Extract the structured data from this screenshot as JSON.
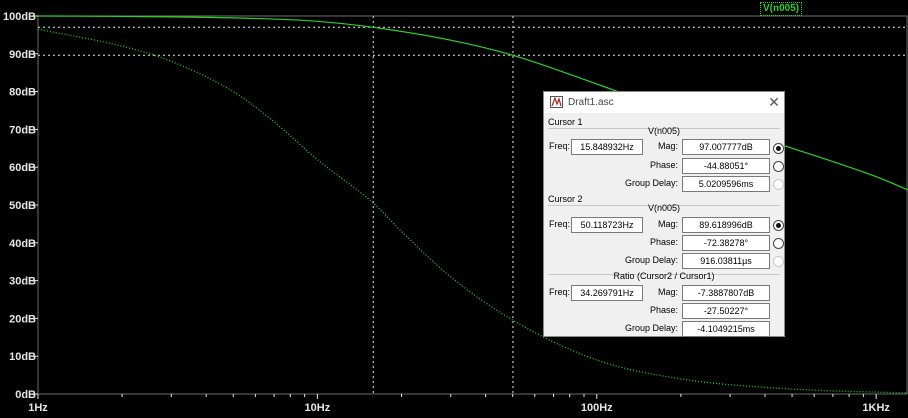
{
  "trace_label": "V(n005)",
  "colors": {
    "background": "#000000",
    "trace": "#2bd12b",
    "grid": "#6b6b6b",
    "axis_text": "#e6e6e6"
  },
  "chart_data": {
    "type": "line",
    "xscale": "log",
    "xlim": [
      1,
      1300
    ],
    "ylim": [
      0,
      100
    ],
    "x_ticks": [
      1,
      10,
      100,
      1000
    ],
    "x_tick_labels": [
      "1Hz",
      "10Hz",
      "100Hz",
      "1KHz"
    ],
    "y_ticks": [
      0,
      10,
      20,
      30,
      40,
      50,
      60,
      70,
      80,
      90,
      100
    ],
    "y_tick_labels": [
      "0dB",
      "10dB",
      "20dB",
      "30dB",
      "40dB",
      "50dB",
      "60dB",
      "70dB",
      "80dB",
      "90dB",
      "100dB"
    ],
    "grid": false,
    "series": [
      {
        "name": "V(n005)",
        "style": "solid",
        "x": [
          1,
          2,
          5,
          10,
          15.85,
          30,
          50.12,
          100,
          200,
          500,
          1000,
          1300
        ],
        "y": [
          100,
          99.9,
          99.5,
          98.6,
          97.0,
          93.6,
          89.6,
          82.0,
          74.0,
          65.0,
          57.5,
          54.0
        ]
      },
      {
        "name": "V(n005)",
        "style": "dotted",
        "x": [
          1,
          2,
          3,
          5,
          7,
          10,
          15.85,
          20,
          30,
          50.12,
          100,
          200,
          500,
          1000,
          1300
        ],
        "y": [
          96.5,
          92,
          88,
          80,
          72,
          62,
          50.5,
          43,
          31,
          19.5,
          9,
          4,
          1.3,
          0.5,
          0.3
        ]
      }
    ],
    "cursors": [
      {
        "freq": 15.848932,
        "mag_db": 97.007777
      },
      {
        "freq": 50.118723,
        "mag_db": 89.618996
      }
    ]
  },
  "dialog": {
    "title": "Draft1.asc",
    "close_icon": "close-icon",
    "cursor1": {
      "header": "Cursor 1",
      "trace": "V(n005)",
      "freq_label": "Freq:",
      "freq": "15.848932Hz",
      "mag_label": "Mag:",
      "mag": "97.007777dB",
      "phase_label": "Phase:",
      "phase": "-44.88051°",
      "gd_label": "Group Delay:",
      "gd": "5.0209596ms"
    },
    "cursor2": {
      "header": "Cursor 2",
      "trace": "V(n005)",
      "freq_label": "Freq:",
      "freq": "50.118723Hz",
      "mag_label": "Mag:",
      "mag": "89.618996dB",
      "phase_label": "Phase:",
      "phase": "-72.38278°",
      "gd_label": "Group Delay:",
      "gd": "916.03811µs"
    },
    "ratio": {
      "header": "Ratio (Cursor2 / Cursor1)",
      "freq_label": "Freq:",
      "freq": "34.269791Hz",
      "mag_label": "Mag:",
      "mag": "-7.3887807dB",
      "phase_label": "Phase:",
      "phase": "-27.50227°",
      "gd_label": "Group Delay:",
      "gd": "-4.1049215ms"
    }
  }
}
